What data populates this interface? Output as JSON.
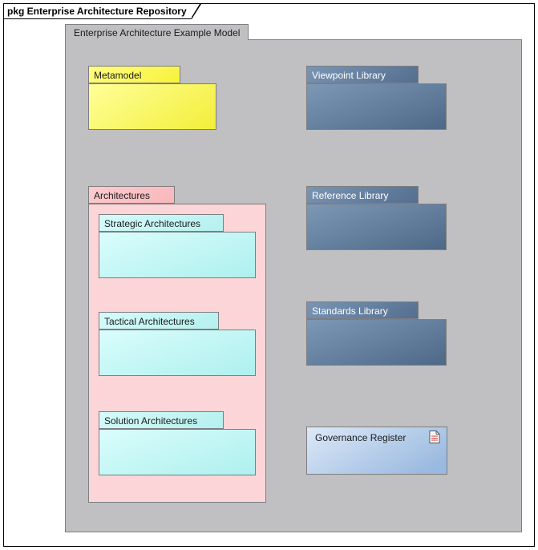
{
  "frame": {
    "title": "pkg Enterprise Architecture Repository"
  },
  "model": {
    "title": "Enterprise Architecture Example Model"
  },
  "packages": {
    "metamodel": "Metamodel",
    "viewpoint": "Viewpoint Library",
    "reference": "Reference Library",
    "standards": "Standards Library",
    "governance": "Governance Register",
    "architectures": {
      "label": "Architectures",
      "children": {
        "strategic": "Strategic Architectures",
        "tactical": "Tactical Architectures",
        "solution": "Solution Architectures"
      }
    }
  }
}
